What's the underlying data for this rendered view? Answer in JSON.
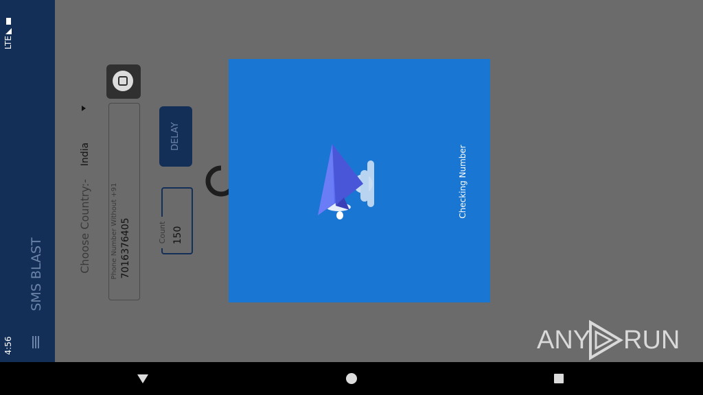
{
  "status_bar": {
    "time": "4:56",
    "network": "LTE"
  },
  "app": {
    "title": "SMS BLAST",
    "choose_country_label": "Choose Country:-",
    "country_value": "India",
    "phone_field_label": "Phone Number Without +91",
    "phone_field_value": "7016376405",
    "delay_button_label": "DELAY",
    "count_label": "Count",
    "count_value": "150"
  },
  "dialog": {
    "message": "Checking Number"
  },
  "watermark": {
    "text_left": "ANY",
    "text_right": "RUN"
  },
  "colors": {
    "primary_dark": "#132f58",
    "dialog_bg": "#1976d2",
    "scrim": "#6b6b6b"
  }
}
